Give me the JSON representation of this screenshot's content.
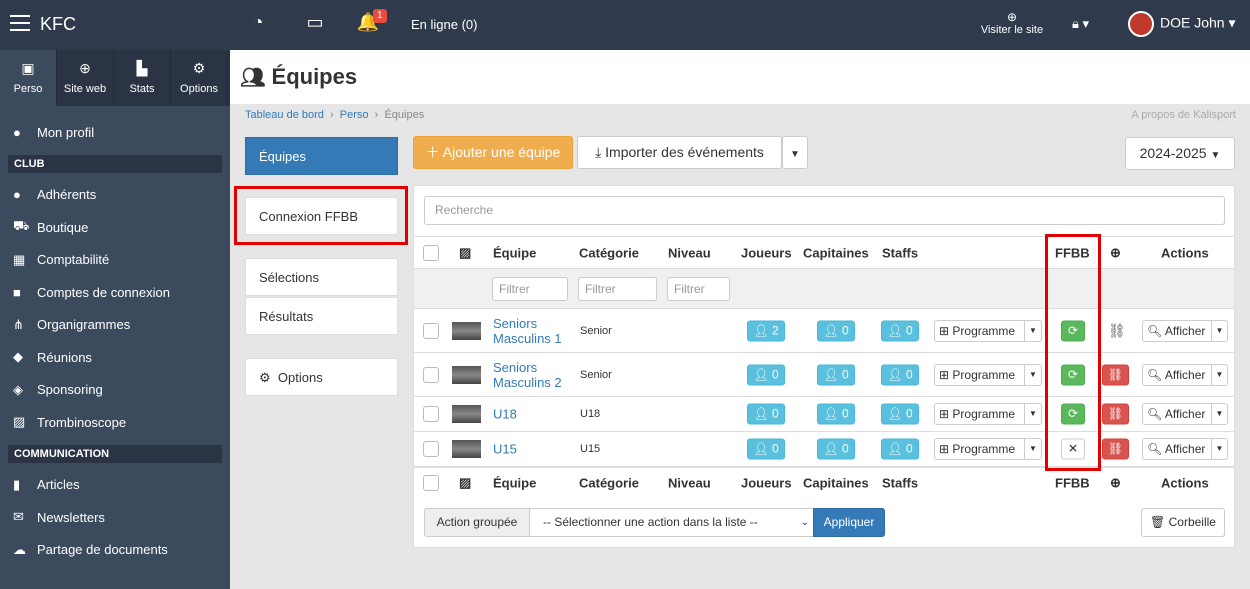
{
  "app": {
    "name": "KFC"
  },
  "topbar": {
    "badge": "1",
    "online": "En ligne (0)",
    "visit": "Visiter le site",
    "user": "DOE John"
  },
  "sidebar": {
    "tabs": [
      {
        "label": "Perso",
        "icon": "id-card-icon"
      },
      {
        "label": "Site web",
        "icon": "globe-icon"
      },
      {
        "label": "Stats",
        "icon": "chart-icon"
      },
      {
        "label": "Options",
        "icon": "gears-icon"
      }
    ],
    "profile": "Mon profil",
    "club_header": "CLUB",
    "club_items": [
      "Adhérents",
      "Boutique",
      "Comptabilité",
      "Comptes de connexion",
      "Organigrammes",
      "Réunions",
      "Sponsoring",
      "Trombinoscope"
    ],
    "comm_header": "COMMUNICATION",
    "comm_items": [
      "Articles",
      "Newsletters",
      "Partage de documents"
    ]
  },
  "page": {
    "title": "Équipes"
  },
  "breadcrumb": {
    "items": [
      "Tableau de bord",
      "Perso",
      "Équipes"
    ],
    "about": "A propos de Kalisport"
  },
  "leftnav": {
    "equipes": "Équipes",
    "ffbb": "Connexion FFBB",
    "selections": "Sélections",
    "resultats": "Résultats",
    "options": "Options"
  },
  "toolbar": {
    "add": "Ajouter une équipe",
    "import": "Importer des événements",
    "season": "2024-2025"
  },
  "table": {
    "search_placeholder": "Recherche",
    "headers": {
      "equipe": "Équipe",
      "categorie": "Catégorie",
      "niveau": "Niveau",
      "joueurs": "Joueurs",
      "capitaines": "Capitaines",
      "staffs": "Staffs",
      "ffbb": "FFBB",
      "actions": "Actions"
    },
    "filter_placeholder": "Filtrer",
    "programme": "Programme",
    "afficher": "Afficher",
    "rows": [
      {
        "name": "Seniors Masculins 1",
        "category": "Senior",
        "players": "2",
        "captains": "0",
        "staffs": "0",
        "ffbb": "synced"
      },
      {
        "name": "Seniors Masculins 2",
        "category": "Senior",
        "players": "0",
        "captains": "0",
        "staffs": "0",
        "ffbb": "synced"
      },
      {
        "name": "U18",
        "category": "U18",
        "players": "0",
        "captains": "0",
        "staffs": "0",
        "ffbb": "synced"
      },
      {
        "name": "U15",
        "category": "U15",
        "players": "0",
        "captains": "0",
        "staffs": "0",
        "ffbb": "not-synced"
      }
    ]
  },
  "bulk": {
    "label": "Action groupée",
    "select": "-- Sélectionner une action dans la liste --",
    "apply": "Appliquer",
    "trash": "Corbeille"
  },
  "colors": {
    "topbar": "#2f3b4d",
    "sidebar": "#3c4a5e",
    "primary": "#337ab7",
    "warning": "#f0ad4e",
    "success": "#5cb85c",
    "danger": "#d9534f",
    "info": "#5bc0de",
    "highlight": "#e00000"
  }
}
